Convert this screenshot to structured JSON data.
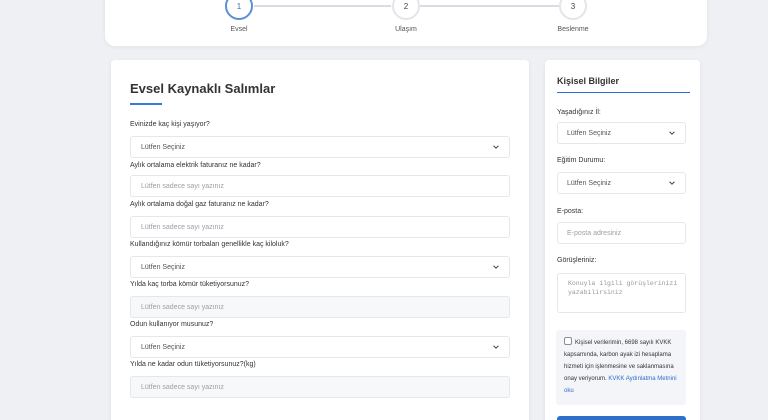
{
  "stepper": {
    "steps": [
      {
        "number": "1",
        "label": "Evsel"
      },
      {
        "number": "2",
        "label": "Ulaşım"
      },
      {
        "number": "3",
        "label": "Beslenme"
      }
    ],
    "active_step": 1
  },
  "form": {
    "title": "Evsel Kaynaklı Salımlar",
    "questions": [
      {
        "label": "Evinizde kaç kişi yaşıyor?",
        "type": "select",
        "value": "Lütfen Seçiniz"
      },
      {
        "label": "Aylık ortalama elektrik faturanız ne kadar?",
        "type": "input",
        "placeholder": "Lütfen sadece sayı yazınız"
      },
      {
        "label": "Aylık ortalama doğal gaz faturanız ne kadar?",
        "type": "input",
        "placeholder": "Lütfen sadece sayı yazınız"
      },
      {
        "label": "Kullandığınız kömür torbaları genellikle kaç kiloluk?",
        "type": "select",
        "value": "Lütfen Seçiniz"
      },
      {
        "label": "Yılda kaç torba kömür tüketiyorsunuz?",
        "type": "input",
        "placeholder": "Lütfen sadece sayı yazınız"
      },
      {
        "label": "Odun kullanıyor musunuz?",
        "type": "select",
        "value": "Lütfen Seçiniz"
      },
      {
        "label": "Yılda ne kadar odun tüketiyorsunuz?(kg)",
        "type": "input",
        "placeholder": "Lütfen sadece sayı yazınız"
      }
    ]
  },
  "personal": {
    "title": "Kişisel Bilgiler",
    "city_label": "Yaşadığınız İl:",
    "city_value": "Lütfen Seçiniz",
    "education_label": "Eğitim Durumu:",
    "education_value": "Lütfen Seçiniz",
    "email_label": "E-posta:",
    "email_placeholder": "E-posta adresiniz",
    "comments_label": "Görüşleriniz:",
    "comments_placeholder": "Konuyla ilgili görüşlerinizi yazabilirsiniz",
    "consent_text": "Kişisel verilerimin, 6698 sayılı KVKK kapsamında, karbon ayak izi hesaplama hizmeti için işlenmesine ve saklanmasına onay veriyorum.",
    "consent_link": "KVKK Aydınlatma Metnini oku"
  },
  "colors": {
    "accent": "#2f6fc9",
    "background": "#eef0f3"
  }
}
